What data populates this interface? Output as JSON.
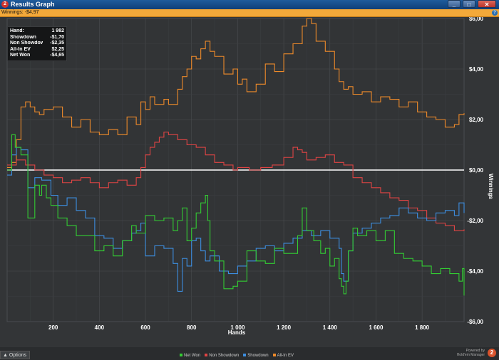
{
  "window": {
    "title": "Results Graph",
    "app_icon_text": "2",
    "controls": {
      "minimize": "_",
      "maximize": "□",
      "close": "✕"
    }
  },
  "summary_bar": {
    "text": "Winnings: -$4,97",
    "help_icon": "?"
  },
  "stats": [
    {
      "label": "Hand:",
      "value": "1 982"
    },
    {
      "label": "Showdown",
      "value": "-$1,70"
    },
    {
      "label": "Non Showdow",
      "value": "-$2,35"
    },
    {
      "label": "All-In EV",
      "value": "$2,25"
    },
    {
      "label": "Net Won",
      "value": "-$4,65"
    }
  ],
  "footer": {
    "options_label": "Options",
    "options_icon": "up-arrow",
    "powered_by": "Powered by",
    "brand": "Hold'em Manager",
    "brand_logo_text": "2"
  },
  "colors": {
    "Net Won": "#33cc33",
    "Non Showdown": "#e04444",
    "Showdown": "#3d8ee0",
    "All-In EV": "#ee8a2a",
    "zero_line": "#ffffff",
    "grid": "#4a4d50"
  },
  "chart_data": {
    "type": "line",
    "xlabel": "Hands",
    "ylabel": "Winnings",
    "xlim": [
      0,
      1982
    ],
    "ylim": [
      -6,
      6
    ],
    "x_ticks": [
      "200",
      "400",
      "600",
      "800",
      "1 000",
      "1 200",
      "1 400",
      "1 600",
      "1 800"
    ],
    "x_tick_values": [
      200,
      400,
      600,
      800,
      1000,
      1200,
      1400,
      1600,
      1800
    ],
    "y_ticks": [
      "$6,00",
      "$4,00",
      "$2,00",
      "$0,00",
      "-$2,00",
      "-$4,00",
      "-$6,00"
    ],
    "y_tick_values": [
      6,
      4,
      2,
      0,
      -2,
      -4,
      -6
    ],
    "grid": true,
    "legend_position": "bottom",
    "series": [
      {
        "name": "Net Won",
        "x": [
          0,
          20,
          35,
          60,
          90,
          120,
          140,
          150,
          170,
          190,
          220,
          260,
          300,
          340,
          380,
          420,
          460,
          500,
          540,
          560,
          600,
          640,
          680,
          720,
          740,
          760,
          780,
          800,
          820,
          840,
          860,
          870,
          880,
          900,
          940,
          980,
          1000,
          1040,
          1080,
          1120,
          1160,
          1200,
          1240,
          1260,
          1280,
          1300,
          1330,
          1360,
          1380,
          1400,
          1420,
          1440,
          1450,
          1460,
          1470,
          1480,
          1500,
          1520,
          1560,
          1600,
          1640,
          1680,
          1720,
          1760,
          1800,
          1840,
          1880,
          1920,
          1960,
          1975,
          1982
        ],
        "y": [
          0,
          1.4,
          0.9,
          0.6,
          -1.9,
          -0.6,
          -1.0,
          -0.6,
          -1.1,
          -1.4,
          -1.9,
          -2.2,
          -2.6,
          -2.6,
          -3.2,
          -3.0,
          -3.4,
          -2.8,
          -2.2,
          -2.5,
          -1.8,
          -2.0,
          -1.9,
          -2.4,
          -2.0,
          -1.5,
          -2.8,
          -2.3,
          -1.7,
          -1.3,
          -1.0,
          -2.0,
          -3.2,
          -3.6,
          -4.7,
          -4.6,
          -4.4,
          -3.2,
          -3.6,
          -3.7,
          -3.1,
          -3.3,
          -3.3,
          -2.6,
          -1.5,
          -2.4,
          -2.8,
          -3.3,
          -3.1,
          -3.8,
          -3.5,
          -4.3,
          -4.6,
          -4.9,
          -4.4,
          -3.2,
          -2.3,
          -2.6,
          -2.4,
          -2.8,
          -2.4,
          -3.3,
          -3.5,
          -3.6,
          -3.8,
          -4.1,
          -3.9,
          -4.1,
          -4.4,
          -3.9,
          -4.97
        ]
      },
      {
        "name": "Non Showdown",
        "x": [
          0,
          40,
          80,
          120,
          160,
          200,
          240,
          280,
          320,
          360,
          400,
          440,
          480,
          520,
          560,
          580,
          600,
          620,
          640,
          660,
          680,
          700,
          740,
          780,
          820,
          860,
          900,
          940,
          980,
          1000,
          1050,
          1100,
          1150,
          1200,
          1240,
          1260,
          1280,
          1300,
          1340,
          1380,
          1420,
          1460,
          1500,
          1540,
          1580,
          1620,
          1660,
          1700,
          1740,
          1780,
          1820,
          1860,
          1900,
          1940,
          1982
        ],
        "y": [
          0.2,
          0.4,
          0.2,
          0.0,
          -0.2,
          -0.3,
          -0.5,
          -0.4,
          -0.3,
          -0.5,
          -0.7,
          -0.5,
          -0.4,
          -0.6,
          -0.3,
          0.1,
          0.6,
          0.9,
          1.1,
          1.3,
          1.5,
          1.4,
          1.2,
          1.0,
          0.9,
          0.6,
          0.3,
          0.2,
          0.0,
          0.1,
          0.0,
          0.1,
          0.2,
          0.5,
          0.9,
          0.8,
          0.7,
          0.4,
          0.5,
          0.6,
          0.3,
          0.2,
          -0.3,
          -0.5,
          -0.7,
          -0.9,
          -1.1,
          -1.2,
          -1.5,
          -1.6,
          -1.9,
          -2.1,
          -2.2,
          -2.4,
          -2.35
        ]
      },
      {
        "name": "Showdown",
        "x": [
          0,
          20,
          40,
          60,
          90,
          120,
          150,
          190,
          220,
          260,
          300,
          340,
          380,
          420,
          460,
          500,
          540,
          560,
          580,
          600,
          640,
          680,
          720,
          740,
          760,
          780,
          800,
          820,
          840,
          860,
          880,
          920,
          960,
          1000,
          1040,
          1080,
          1120,
          1160,
          1200,
          1240,
          1280,
          1320,
          1360,
          1400,
          1440,
          1450,
          1460,
          1480,
          1500,
          1540,
          1580,
          1620,
          1660,
          1700,
          1740,
          1780,
          1820,
          1860,
          1900,
          1940,
          1960,
          1982
        ],
        "y": [
          -0.2,
          0.6,
          0.9,
          0.8,
          -0.7,
          -0.3,
          -0.4,
          -1.0,
          -1.4,
          -1.1,
          -1.6,
          -1.9,
          -2.6,
          -2.7,
          -3.1,
          -2.8,
          -2.5,
          -2.4,
          -2.1,
          -3.4,
          -3.0,
          -3.1,
          -3.7,
          -4.8,
          -3.5,
          -3.8,
          -2.8,
          -2.7,
          -3.2,
          -3.6,
          -3.4,
          -4.0,
          -4.1,
          -3.8,
          -3.6,
          -3.1,
          -3.0,
          -3.2,
          -2.9,
          -2.7,
          -2.4,
          -2.6,
          -2.4,
          -2.7,
          -3.1,
          -4.1,
          -4.4,
          -3.2,
          -2.5,
          -2.3,
          -2.1,
          -1.9,
          -1.8,
          -1.5,
          -1.7,
          -1.9,
          -2.0,
          -1.7,
          -1.6,
          -1.8,
          -1.3,
          -1.7
        ]
      },
      {
        "name": "All-In EV",
        "x": [
          0,
          20,
          40,
          60,
          80,
          100,
          120,
          140,
          160,
          200,
          240,
          280,
          320,
          360,
          400,
          440,
          480,
          520,
          560,
          580,
          600,
          620,
          640,
          680,
          700,
          740,
          760,
          780,
          800,
          820,
          840,
          860,
          880,
          900,
          940,
          980,
          1000,
          1020,
          1040,
          1080,
          1120,
          1160,
          1200,
          1240,
          1280,
          1300,
          1320,
          1340,
          1380,
          1420,
          1440,
          1460,
          1480,
          1500,
          1540,
          1580,
          1620,
          1660,
          1700,
          1740,
          1780,
          1820,
          1860,
          1900,
          1940,
          1960,
          1982
        ],
        "y": [
          0.1,
          0.3,
          1.2,
          2.5,
          2.7,
          2.5,
          2.3,
          2.2,
          2.4,
          2.5,
          2.1,
          1.7,
          2.0,
          1.5,
          1.4,
          1.6,
          1.4,
          2.1,
          1.8,
          2.7,
          2.4,
          2.9,
          2.6,
          2.8,
          2.6,
          3.2,
          3.7,
          4.0,
          4.5,
          4.4,
          4.8,
          5.1,
          4.7,
          4.5,
          3.8,
          4.0,
          3.4,
          3.6,
          3.1,
          3.4,
          4.2,
          3.9,
          4.6,
          5.0,
          5.7,
          6.0,
          5.8,
          5.1,
          4.7,
          4.0,
          3.5,
          3.2,
          3.3,
          3.0,
          3.1,
          2.7,
          2.9,
          2.8,
          2.5,
          2.7,
          2.3,
          2.1,
          2.0,
          1.7,
          1.8,
          2.2,
          2.25
        ]
      }
    ]
  }
}
